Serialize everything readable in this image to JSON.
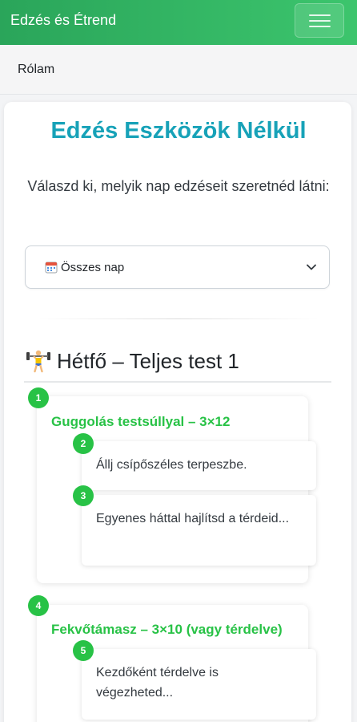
{
  "navbar": {
    "brand": "Edzés és Étrend",
    "menu_icon": "hamburger-menu-icon"
  },
  "subnav": {
    "link": "Rólam"
  },
  "page": {
    "title": "Edzés Eszközök Nélkül",
    "intro": "Válaszd ki, melyik nap edzéseit szeretnéd látni:"
  },
  "day_select": {
    "icon": "calendar-icon",
    "selected": "Összes nap",
    "caret_icon": "chevron-down-icon"
  },
  "day": {
    "icon": "weightlifter-icon",
    "heading": "Hétfő – Teljes test 1"
  },
  "exercises": [
    {
      "badge": "1",
      "title": "Guggolás testsúllyal – 3×12",
      "steps": [
        {
          "badge": "2",
          "text": "Állj csípőszéles terpeszbe."
        },
        {
          "badge": "3",
          "text": "Egyenes háttal hajlítsd a térdeid..."
        }
      ]
    },
    {
      "badge": "4",
      "title": "Fekvőtámasz – 3×10 (vagy térdelve)",
      "steps": [
        {
          "badge": "5",
          "text": "Kezdőként térdelve is végezheted..."
        }
      ]
    }
  ],
  "colors": {
    "navbar": "#2aa55a",
    "title": "#17a2b8",
    "accent": "#28c246"
  }
}
